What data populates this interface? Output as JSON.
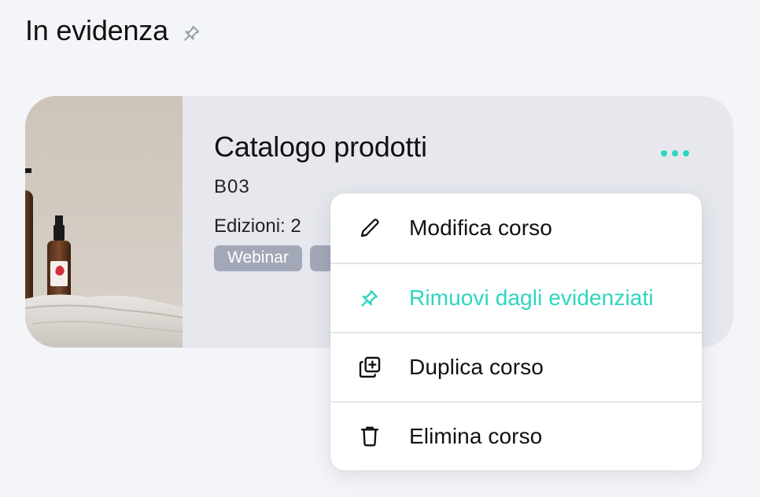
{
  "section": {
    "title": "In evidenza",
    "pin_icon": "pin-outline-icon"
  },
  "course_card": {
    "title": "Catalogo prodotti",
    "code": "B03",
    "editions": "Edizioni: 2",
    "tags": [
      "Webinar",
      ""
    ],
    "more_icon": "more-horizontal-icon"
  },
  "context_menu": {
    "items": [
      {
        "label": "Modifica corso",
        "icon": "pencil-icon"
      },
      {
        "label": "Rimuovi dagli evidenziati",
        "icon": "pin-icon"
      },
      {
        "label": "Duplica corso",
        "icon": "duplicate-icon"
      },
      {
        "label": "Elimina corso",
        "icon": "trash-icon"
      }
    ]
  },
  "colors": {
    "accent": "#2ed6c0",
    "background": "#f4f5f9",
    "card": "#e6e8ee",
    "tag": "#a3a8b8"
  }
}
